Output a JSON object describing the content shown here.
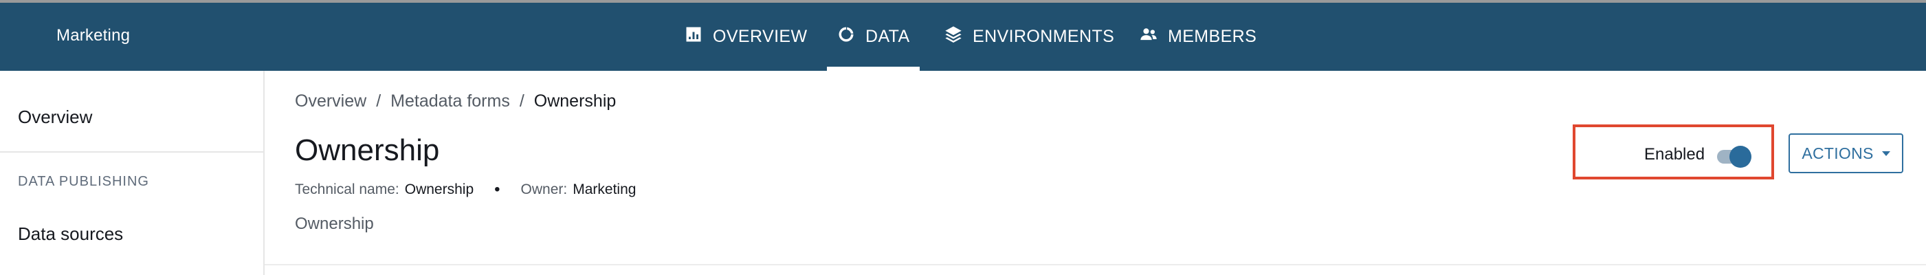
{
  "header": {
    "project_name": "Marketing",
    "tabs": [
      {
        "label": "OVERVIEW",
        "icon": "bar-chart-icon",
        "active": false
      },
      {
        "label": "DATA",
        "icon": "loading-circle-icon",
        "active": true
      },
      {
        "label": "ENVIRONMENTS",
        "icon": "layers-icon",
        "active": false
      },
      {
        "label": "MEMBERS",
        "icon": "users-icon",
        "active": false
      }
    ]
  },
  "sidebar": {
    "overview_label": "Overview",
    "section_label": "DATA PUBLISHING",
    "data_sources_label": "Data sources"
  },
  "breadcrumb": {
    "items": [
      "Overview",
      "Metadata forms",
      "Ownership"
    ],
    "separator": "/"
  },
  "page": {
    "title": "Ownership",
    "technical_name_label": "Technical name:",
    "technical_name_value": "Ownership",
    "owner_label": "Owner:",
    "owner_value": "Marketing",
    "description": "Ownership",
    "enabled_label": "Enabled",
    "enabled": true,
    "actions_label": "ACTIONS"
  },
  "colors": {
    "header_bg": "#21506f",
    "accent": "#2f6f9f",
    "highlight_border": "#e0472f"
  }
}
